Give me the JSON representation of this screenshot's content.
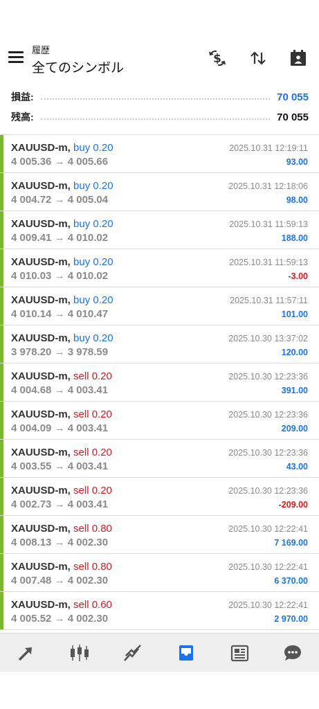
{
  "header": {
    "subtitle": "履歴",
    "title": "全てのシンボル",
    "buttons": [
      "currency-exchange-icon",
      "sort-icon",
      "calendar-period-icon"
    ]
  },
  "summary": {
    "profit_label": "損益:",
    "profit_value": "70 055",
    "balance_label": "残高:",
    "balance_value": "70 055"
  },
  "colors": {
    "buy": "#1a73e8",
    "sell": "#e0161b",
    "positive": "#1a73e8",
    "negative": "#e0161b",
    "bar": "#7cb82f"
  },
  "trades": [
    {
      "symbol": "XAUUSD-m,",
      "type": "buy",
      "volume": "buy 0.20",
      "prices": "4 005.36 → 4 005.66",
      "time": "2025.10.31 12:19:11",
      "profit": "93.00",
      "negative": false
    },
    {
      "symbol": "XAUUSD-m,",
      "type": "buy",
      "volume": "buy 0.20",
      "prices": "4 004.72 → 4 005.04",
      "time": "2025.10.31 12:18:06",
      "profit": "98.00",
      "negative": false
    },
    {
      "symbol": "XAUUSD-m,",
      "type": "buy",
      "volume": "buy 0.20",
      "prices": "4 009.41 → 4 010.02",
      "time": "2025.10.31 11:59:13",
      "profit": "188.00",
      "negative": false
    },
    {
      "symbol": "XAUUSD-m,",
      "type": "buy",
      "volume": "buy 0.20",
      "prices": "4 010.03 → 4 010.02",
      "time": "2025.10.31 11:59:13",
      "profit": "-3.00",
      "negative": true
    },
    {
      "symbol": "XAUUSD-m,",
      "type": "buy",
      "volume": "buy 0.20",
      "prices": "4 010.14 → 4 010.47",
      "time": "2025.10.31 11:57:11",
      "profit": "101.00",
      "negative": false
    },
    {
      "symbol": "XAUUSD-m,",
      "type": "buy",
      "volume": "buy 0.20",
      "prices": "3 978.20 → 3 978.59",
      "time": "2025.10.30 13:37:02",
      "profit": "120.00",
      "negative": false
    },
    {
      "symbol": "XAUUSD-m,",
      "type": "sell",
      "volume": "sell 0.20",
      "prices": "4 004.68 → 4 003.41",
      "time": "2025.10.30 12:23:36",
      "profit": "391.00",
      "negative": false
    },
    {
      "symbol": "XAUUSD-m,",
      "type": "sell",
      "volume": "sell 0.20",
      "prices": "4 004.09 → 4 003.41",
      "time": "2025.10.30 12:23:36",
      "profit": "209.00",
      "negative": false
    },
    {
      "symbol": "XAUUSD-m,",
      "type": "sell",
      "volume": "sell 0.20",
      "prices": "4 003.55 → 4 003.41",
      "time": "2025.10.30 12:23:36",
      "profit": "43.00",
      "negative": false
    },
    {
      "symbol": "XAUUSD-m,",
      "type": "sell",
      "volume": "sell 0.20",
      "prices": "4 002.73 → 4 003.41",
      "time": "2025.10.30 12:23:36",
      "profit": "-209.00",
      "negative": true
    },
    {
      "symbol": "XAUUSD-m,",
      "type": "sell",
      "volume": "sell 0.80",
      "prices": "4 008.13 → 4 002.30",
      "time": "2025.10.30 12:22:41",
      "profit": "7 169.00",
      "negative": false
    },
    {
      "symbol": "XAUUSD-m,",
      "type": "sell",
      "volume": "sell 0.80",
      "prices": "4 007.48 → 4 002.30",
      "time": "2025.10.30 12:22:41",
      "profit": "6 370.00",
      "negative": false
    },
    {
      "symbol": "XAUUSD-m,",
      "type": "sell",
      "volume": "sell 0.60",
      "prices": "4 005.52 → 4 002.30",
      "time": "2025.10.30 12:22:41",
      "profit": "2 970.00",
      "negative": false
    }
  ],
  "bottom_nav": {
    "items": [
      "quotes-icon",
      "chart-icon",
      "trade-icon",
      "history-icon",
      "news-icon",
      "chat-icon"
    ],
    "active": "history-icon",
    "active_color": "#1a73e8"
  }
}
